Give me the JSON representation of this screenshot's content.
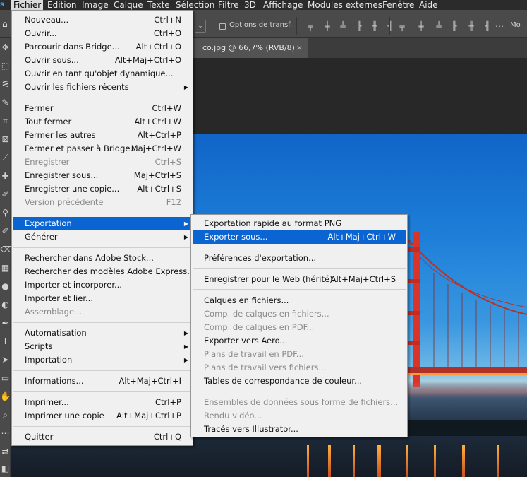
{
  "menubar": {
    "app_icon": "photoshop-logo",
    "items": [
      "Fichier",
      "Edition",
      "Image",
      "Calque",
      "Texte",
      "Sélection",
      "Filtre",
      "3D",
      "Affichage",
      "Modules externes",
      "Fenêtre",
      "Aide"
    ]
  },
  "optionsbar": {
    "checkbox_label": "Options de transf.",
    "more_label": "Mo"
  },
  "document": {
    "tab_title": "co.jpg @ 66,7% (RVB/8)",
    "close_glyph": "×"
  },
  "file_menu": {
    "items": [
      {
        "label": "Nouveau...",
        "shortcut": "Ctrl+N",
        "disabled": false,
        "submenu": false
      },
      {
        "label": "Ouvrir...",
        "shortcut": "Ctrl+O",
        "disabled": false,
        "submenu": false
      },
      {
        "label": "Parcourir dans Bridge...",
        "shortcut": "Alt+Ctrl+O",
        "disabled": false,
        "submenu": false
      },
      {
        "label": "Ouvrir sous...",
        "shortcut": "Alt+Maj+Ctrl+O",
        "disabled": false,
        "submenu": false
      },
      {
        "label": "Ouvrir en tant qu'objet dynamique...",
        "shortcut": "",
        "disabled": false,
        "submenu": false
      },
      {
        "label": "Ouvrir les fichiers récents",
        "shortcut": "",
        "disabled": false,
        "submenu": true
      },
      {
        "label": "Fermer",
        "shortcut": "Ctrl+W",
        "disabled": false,
        "submenu": false
      },
      {
        "label": "Tout fermer",
        "shortcut": "Alt+Ctrl+W",
        "disabled": false,
        "submenu": false
      },
      {
        "label": "Fermer les autres",
        "shortcut": "Alt+Ctrl+P",
        "disabled": false,
        "submenu": false
      },
      {
        "label": "Fermer et passer à Bridge...",
        "shortcut": "Maj+Ctrl+W",
        "disabled": false,
        "submenu": false
      },
      {
        "label": "Enregistrer",
        "shortcut": "Ctrl+S",
        "disabled": true,
        "submenu": false
      },
      {
        "label": "Enregistrer sous...",
        "shortcut": "Maj+Ctrl+S",
        "disabled": false,
        "submenu": false
      },
      {
        "label": "Enregistrer une copie...",
        "shortcut": "Alt+Ctrl+S",
        "disabled": false,
        "submenu": false
      },
      {
        "label": "Version précédente",
        "shortcut": "F12",
        "disabled": true,
        "submenu": false
      },
      {
        "label": "Exportation",
        "shortcut": "",
        "disabled": false,
        "submenu": true,
        "highlighted": true
      },
      {
        "label": "Générer",
        "shortcut": "",
        "disabled": false,
        "submenu": true
      },
      {
        "label": "Rechercher dans Adobe Stock...",
        "shortcut": "",
        "disabled": false,
        "submenu": false
      },
      {
        "label": "Rechercher des modèles Adobe Express...",
        "shortcut": "",
        "disabled": false,
        "submenu": false
      },
      {
        "label": "Importer et incorporer...",
        "shortcut": "",
        "disabled": false,
        "submenu": false
      },
      {
        "label": "Importer et lier...",
        "shortcut": "",
        "disabled": false,
        "submenu": false
      },
      {
        "label": "Assemblage...",
        "shortcut": "",
        "disabled": true,
        "submenu": false
      },
      {
        "label": "Automatisation",
        "shortcut": "",
        "disabled": false,
        "submenu": true
      },
      {
        "label": "Scripts",
        "shortcut": "",
        "disabled": false,
        "submenu": true
      },
      {
        "label": "Importation",
        "shortcut": "",
        "disabled": false,
        "submenu": true
      },
      {
        "label": "Informations...",
        "shortcut": "Alt+Maj+Ctrl+I",
        "disabled": false,
        "submenu": false
      },
      {
        "label": "Imprimer...",
        "shortcut": "Ctrl+P",
        "disabled": false,
        "submenu": false
      },
      {
        "label": "Imprimer une copie",
        "shortcut": "Alt+Maj+Ctrl+P",
        "disabled": false,
        "submenu": false
      },
      {
        "label": "Quitter",
        "shortcut": "Ctrl+Q",
        "disabled": false,
        "submenu": false
      }
    ]
  },
  "export_submenu": {
    "items": [
      {
        "label": "Exportation rapide au format PNG",
        "shortcut": "",
        "disabled": false
      },
      {
        "label": "Exporter sous...",
        "shortcut": "Alt+Maj+Ctrl+W",
        "disabled": false,
        "highlighted": true
      },
      {
        "label": "Préférences d'exportation...",
        "shortcut": "",
        "disabled": false
      },
      {
        "label": "Enregistrer pour le Web (hérité)...",
        "shortcut": "Alt+Maj+Ctrl+S",
        "disabled": false
      },
      {
        "label": "Calques en fichiers...",
        "shortcut": "",
        "disabled": false
      },
      {
        "label": "Comp. de calques en fichiers...",
        "shortcut": "",
        "disabled": true
      },
      {
        "label": "Comp. de calques en PDF...",
        "shortcut": "",
        "disabled": true
      },
      {
        "label": "Exporter vers Aero...",
        "shortcut": "",
        "disabled": false
      },
      {
        "label": "Plans de travail en PDF...",
        "shortcut": "",
        "disabled": true
      },
      {
        "label": "Plans de travail vers fichiers...",
        "shortcut": "",
        "disabled": true
      },
      {
        "label": "Tables de correspondance de couleur...",
        "shortcut": "",
        "disabled": false
      },
      {
        "label": "Ensembles de données sous forme de fichiers...",
        "shortcut": "",
        "disabled": true
      },
      {
        "label": "Rendu vidéo...",
        "shortcut": "",
        "disabled": true
      },
      {
        "label": "Tracés vers Illustrator...",
        "shortcut": "",
        "disabled": false
      }
    ]
  },
  "colors": {
    "menu_bg": "#f0f0f0",
    "highlight": "#0a64d2",
    "bridge_red": "#d8342a",
    "app_chrome": "#2b2b2b"
  }
}
